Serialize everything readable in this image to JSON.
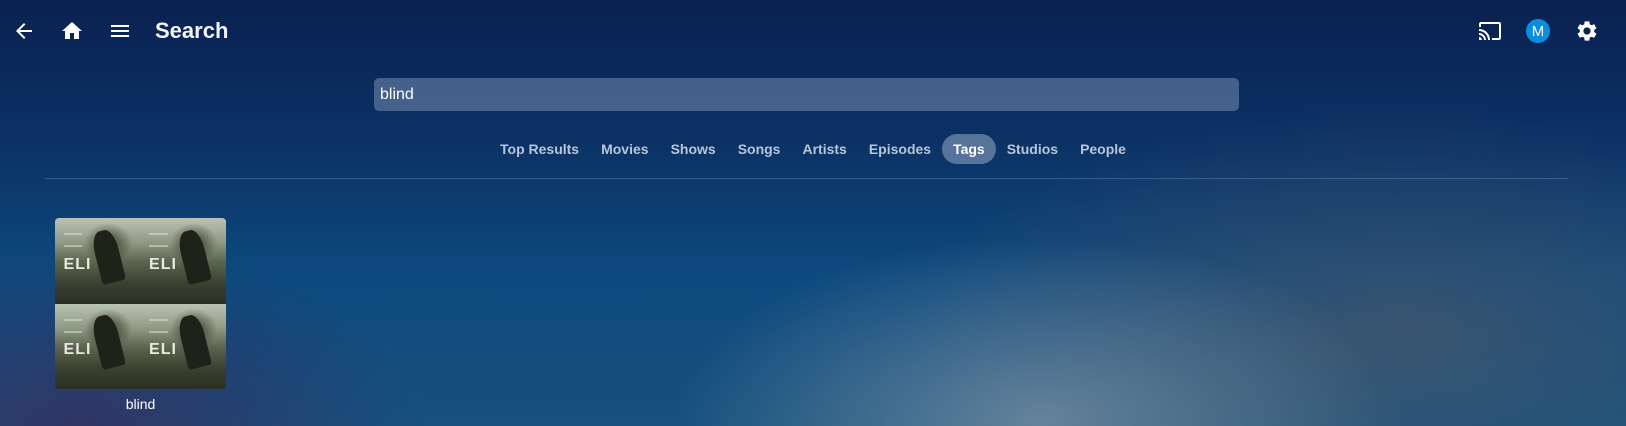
{
  "header": {
    "title": "Search",
    "avatar_letter": "M",
    "accent_color": "#0a8ee0"
  },
  "icons": [
    "back-arrow-icon",
    "home-icon",
    "menu-icon",
    "cast-icon",
    "user-avatar",
    "gear-icon"
  ],
  "search": {
    "value": "blind"
  },
  "tabs": [
    {
      "label": "Top Results",
      "active": false
    },
    {
      "label": "Movies",
      "active": false
    },
    {
      "label": "Shows",
      "active": false
    },
    {
      "label": "Songs",
      "active": false
    },
    {
      "label": "Artists",
      "active": false
    },
    {
      "label": "Episodes",
      "active": false
    },
    {
      "label": "Tags",
      "active": true
    },
    {
      "label": "Studios",
      "active": false
    },
    {
      "label": "People",
      "active": false
    }
  ],
  "results": [
    {
      "label": "blind",
      "poster_text": "ELI"
    }
  ]
}
